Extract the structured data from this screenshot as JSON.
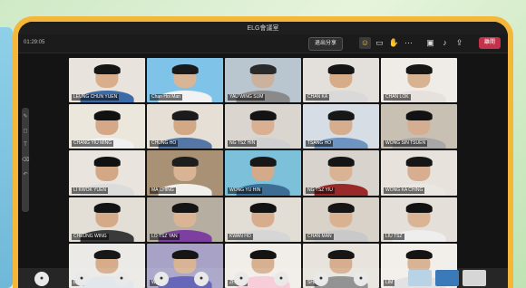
{
  "window": {
    "title": "ELG會議室"
  },
  "toolbar": {
    "timer": "01:29:05",
    "share_label": "退出分享",
    "leave_label": "離開",
    "icons": [
      "people-icon",
      "chat-icon",
      "raise-hand-icon",
      "more-icon",
      "camera-icon",
      "mic-icon",
      "share-icon"
    ]
  },
  "participants": [
    {
      "name": "LEUNG CHUN YUEN",
      "bg": "#e8e3dc",
      "hair": "#151515",
      "skin": "#d8ae8c",
      "shirt": "#3d6aa8"
    },
    {
      "name": "Chan Hoi Man",
      "bg": "#7fc3e8",
      "hair": "#1a1a1a",
      "skin": "#d9b597",
      "shirt": "#f2f2f2"
    },
    {
      "name": "YAU WING SUM",
      "bg": "#b9c5cf",
      "hair": "#2a2a2a",
      "skin": "#ccb29c",
      "shirt": "#8a8a8a"
    },
    {
      "name": "CHAN KA",
      "bg": "#e3e0db",
      "hair": "#141414",
      "skin": "#d6ac89",
      "shirt": "#d9d9d9"
    },
    {
      "name": "CHAN LOK",
      "bg": "#efebe6",
      "hair": "#161616",
      "skin": "#d8b392",
      "shirt": "#e6e1dd"
    },
    {
      "name": "CHANG YIU MING",
      "bg": "#ece7dd",
      "hair": "#111",
      "skin": "#d5a987",
      "shirt": "#f0f0f0"
    },
    {
      "name": "CHUNG HO",
      "bg": "#e5dfd6",
      "hair": "#1b1b1b",
      "skin": "#d2a885",
      "shirt": "#5477a5"
    },
    {
      "name": "NG TSZ HIN",
      "bg": "#dad6cf",
      "hair": "#141414",
      "skin": "#d9b192",
      "shirt": "#d0d0d0"
    },
    {
      "name": "TSANG HO",
      "bg": "#d7dde4",
      "hair": "#171717",
      "skin": "#d6ad8d",
      "shirt": "#6e95c2"
    },
    {
      "name": "WONG SIN TSUEN",
      "bg": "#c9c0b4",
      "hair": "#121212",
      "skin": "#d5ad90",
      "shirt": "#a7a7a7"
    },
    {
      "name": "LI KWOK YUEN",
      "bg": "#e9e4de",
      "hair": "#111",
      "skin": "#d3a886",
      "shirt": "#dcdcdc"
    },
    {
      "name": "MA CHING",
      "bg": "#a89175",
      "hair": "#1d1d1d",
      "skin": "#d8b394",
      "shirt": "#f1efe9"
    },
    {
      "name": "WONG YU HIN",
      "bg": "#7cc0d9",
      "hair": "#181818",
      "skin": "#d4ab8a",
      "shirt": "#3c6e95"
    },
    {
      "name": "NG TSZ YIU",
      "bg": "#d8d3cc",
      "hair": "#151515",
      "skin": "#d9b393",
      "shirt": "#9a2a2a"
    },
    {
      "name": "WONG KA CHING",
      "bg": "#e7e2db",
      "hair": "#161616",
      "skin": "#d7af90",
      "shirt": "#eae6e1"
    },
    {
      "name": "CHEUNG WING",
      "bg": "#e3ded6",
      "hair": "#131313",
      "skin": "#d4aa88",
      "shirt": "#3a3a3a"
    },
    {
      "name": "LO TSZ YAN",
      "bg": "#b7aea2",
      "hair": "#141414",
      "skin": "#d9b596",
      "shirt": "#7d3fa0"
    },
    {
      "name": "KWAN HO",
      "bg": "#e2ddd5",
      "hair": "#121212",
      "skin": "#d6ae8e",
      "shirt": "#d6d6d6"
    },
    {
      "name": "CHAN MAN",
      "bg": "#d8d2c9",
      "hair": "#151515",
      "skin": "#d8b291",
      "shirt": "#c9c9c9"
    },
    {
      "name": "LIU TSZ",
      "bg": "#e4dfd8",
      "hair": "#111",
      "skin": "#d9b595",
      "shirt": "#eeeeee"
    },
    {
      "name": "LAU",
      "bg": "#eceae6",
      "hair": "#171717",
      "skin": "#d6ac8b",
      "shirt": "#dfe5ea"
    },
    {
      "name": "WAN",
      "bg": "#a7a2c6",
      "hair": "#151515",
      "skin": "#d8b495",
      "shirt": "#5b5bb3"
    },
    {
      "name": "ZHANG",
      "bg": "#f1ede8",
      "hair": "#131313",
      "skin": "#d7b090",
      "shirt": "#f7c9d6"
    },
    {
      "name": "SHU",
      "bg": "#e8e3dd",
      "hair": "#161616",
      "skin": "#d6ae8f",
      "shirt": "#8a8a8a"
    },
    {
      "name": "LIM",
      "bg": "#f2efea",
      "hair": "#141414",
      "skin": "#d8b394",
      "shirt": "#e0e0e0"
    }
  ],
  "dock": {
    "icons": [
      {
        "name": "dock-app-1-icon",
        "glyph": "●"
      },
      {
        "name": "dock-app-2-icon",
        "glyph": "●"
      },
      {
        "name": "dock-app-3-icon",
        "glyph": "●"
      },
      {
        "name": "dock-app-4-icon",
        "glyph": "●"
      },
      {
        "name": "dock-app-5-icon",
        "glyph": "●"
      },
      {
        "name": "dock-app-6-icon",
        "glyph": "●"
      },
      {
        "name": "dock-app-7-icon",
        "glyph": "●"
      },
      {
        "name": "dock-app-8-icon",
        "glyph": "●"
      },
      {
        "name": "dock-app-9-icon",
        "glyph": "●"
      }
    ],
    "thumbnails": [
      "#b8d3e6",
      "#3a7ab8",
      "#d6d6d6"
    ]
  },
  "colors": {
    "frame": "#f4b73a",
    "window": "#141414",
    "leave": "#c4314b"
  }
}
